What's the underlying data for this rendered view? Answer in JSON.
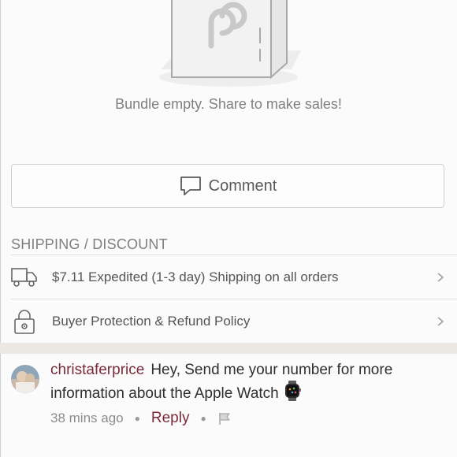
{
  "bundle": {
    "empty_message": "Bundle empty. Share to make sales!",
    "illustration_icon": "poshmark-bag-icon"
  },
  "comment_button": {
    "label": "Comment",
    "icon": "speech-bubble-icon"
  },
  "shipping_discount": {
    "title": "SHIPPING / DISCOUNT",
    "rows": [
      {
        "icon": "truck-icon",
        "label": "$7.11 Expedited (1-3 day) Shipping on all orders"
      },
      {
        "icon": "lock-icon",
        "label": "Buyer Protection & Refund Policy"
      }
    ]
  },
  "comments": [
    {
      "username": "christaferprice",
      "text": "Hey, Send me your number for more information about the Apple Watch",
      "emoji": "watch-emoji",
      "time": "38 mins ago",
      "reply_label": "Reply",
      "flag_icon": "flag-icon"
    }
  ],
  "colors": {
    "accent": "#7a2a3a",
    "background": "#fcfbfc",
    "divider_band": "#ebe7e3"
  }
}
